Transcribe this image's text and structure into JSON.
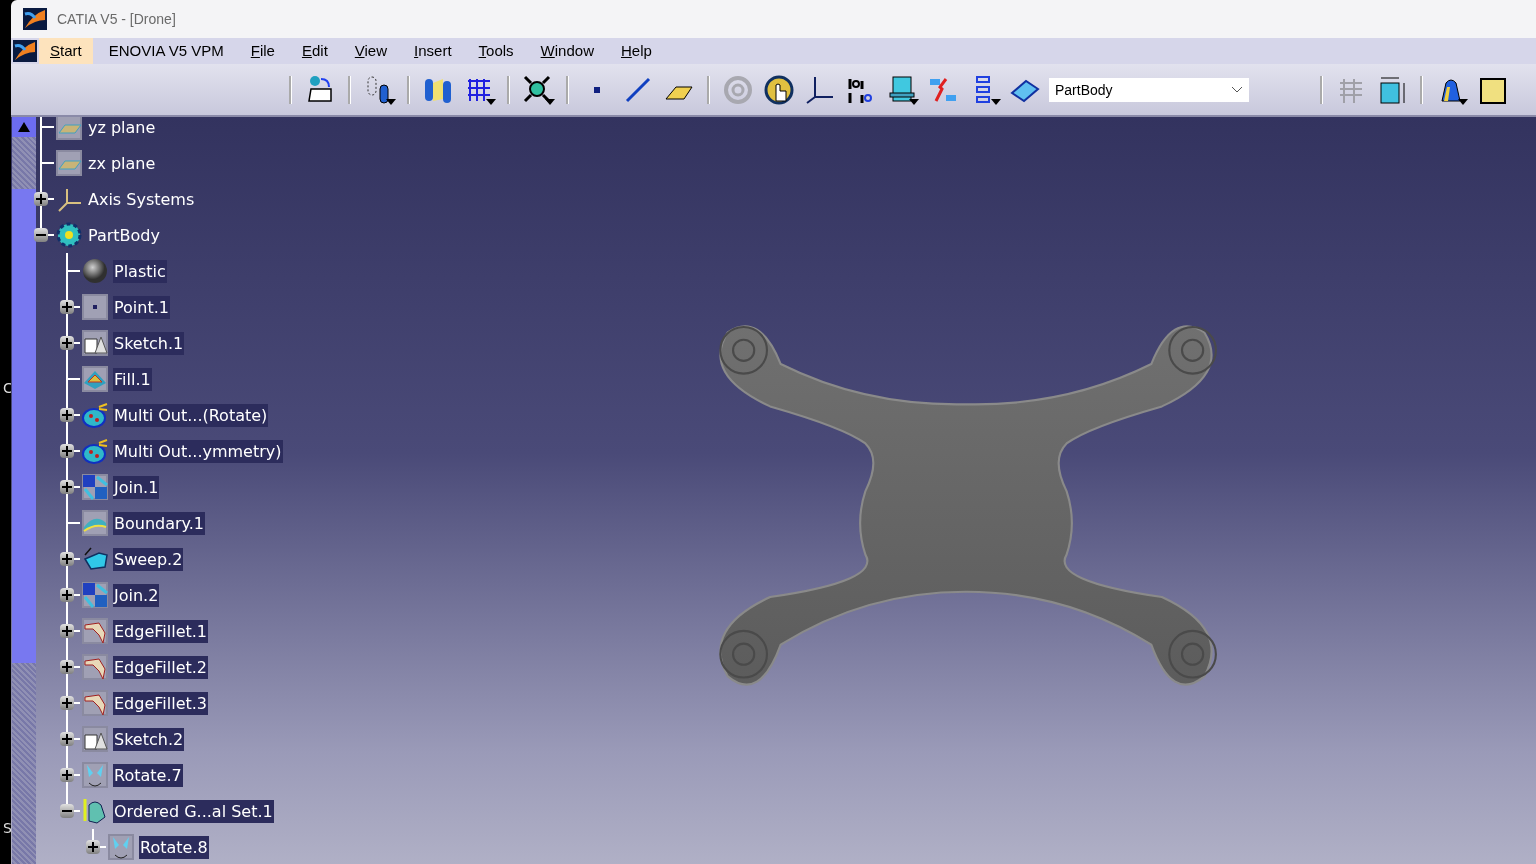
{
  "window": {
    "title": "CATIA V5 - [Drone]"
  },
  "menu": [
    {
      "label": "Start",
      "mnemonic": true,
      "selected": true
    },
    {
      "label": "ENOVIA V5 VPM",
      "mnemonic": false,
      "selected": false
    },
    {
      "label": "File",
      "mnemonic": true,
      "selected": false
    },
    {
      "label": "Edit",
      "mnemonic": true,
      "selected": false
    },
    {
      "label": "View",
      "mnemonic": true,
      "selected": false
    },
    {
      "label": "Insert",
      "mnemonic": true,
      "selected": false
    },
    {
      "label": "Tools",
      "mnemonic": true,
      "selected": false
    },
    {
      "label": "Window",
      "mnemonic": true,
      "selected": false
    },
    {
      "label": "Help",
      "mnemonic": true,
      "selected": false
    }
  ],
  "toolbar": {
    "body_dropdown": {
      "value": "PartBody"
    }
  },
  "edge_letters": [
    "C",
    "S"
  ],
  "tree": [
    {
      "label": "yz plane",
      "kind": "plane"
    },
    {
      "label": "zx plane",
      "kind": "plane"
    },
    {
      "label": "Axis Systems",
      "kind": "axis",
      "expanded": false
    },
    {
      "label": "PartBody",
      "kind": "body",
      "expanded": true,
      "children": [
        {
          "label": "Plastic",
          "kind": "material"
        },
        {
          "label": "Point.1",
          "kind": "point",
          "expanded": false
        },
        {
          "label": "Sketch.1",
          "kind": "sketch",
          "expanded": false
        },
        {
          "label": "Fill.1",
          "kind": "fill"
        },
        {
          "label": "Multi Out...(Rotate)",
          "kind": "multi",
          "expanded": false
        },
        {
          "label": "Multi Out...ymmetry)",
          "kind": "multi",
          "expanded": false
        },
        {
          "label": "Join.1",
          "kind": "join",
          "expanded": false
        },
        {
          "label": "Boundary.1",
          "kind": "boundary"
        },
        {
          "label": "Sweep.2",
          "kind": "sweep",
          "expanded": false
        },
        {
          "label": "Join.2",
          "kind": "join",
          "expanded": false
        },
        {
          "label": "EdgeFillet.1",
          "kind": "fillet",
          "expanded": false
        },
        {
          "label": "EdgeFillet.2",
          "kind": "fillet",
          "expanded": false
        },
        {
          "label": "EdgeFillet.3",
          "kind": "fillet",
          "expanded": false
        },
        {
          "label": "Sketch.2",
          "kind": "sketch",
          "expanded": false
        },
        {
          "label": "Rotate.7",
          "kind": "rotate",
          "expanded": false
        },
        {
          "label": "Ordered G...al Set.1",
          "kind": "set",
          "expanded": true,
          "children": [
            {
              "label": "Rotate.8",
              "kind": "rotate",
              "expanded": false
            }
          ]
        }
      ]
    }
  ]
}
